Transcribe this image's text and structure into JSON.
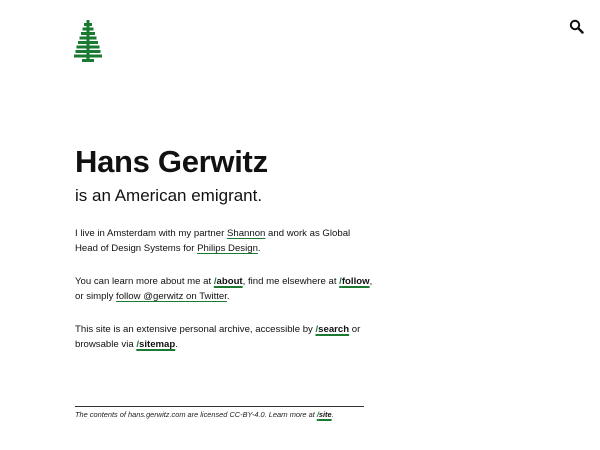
{
  "brand": {
    "logo_icon": "pine-tree-icon",
    "accent_color": "#1a7a32"
  },
  "header": {
    "search_icon": "search-icon"
  },
  "hero": {
    "name": "Hans Gerwitz",
    "tagline": "is an American emigrant."
  },
  "intro": {
    "text_1": "I live in Amsterdam with my partner ",
    "partner_link": "Shannon",
    "text_2": " and work as Global Head of Design Systems for ",
    "employer_link": "Philips Design",
    "text_3": "."
  },
  "learn": {
    "text_1": "You can learn more about me at ",
    "about_link": "about",
    "text_2": ", find me elsewhere at ",
    "follow_link": "follow",
    "text_3": ", or simply ",
    "twitter_link": "follow @gerwitz on Twitter",
    "text_4": "."
  },
  "archive": {
    "text_1": "This site is an extensive personal archive, accessible by ",
    "search_link": "search",
    "text_2": " or browsable via ",
    "sitemap_link": "sitemap",
    "text_3": "."
  },
  "footer": {
    "text": "The contents of hans.gerwitz.com are licensed CC-BY-4.0. Learn more at ",
    "site_link": "site",
    "end": "."
  }
}
